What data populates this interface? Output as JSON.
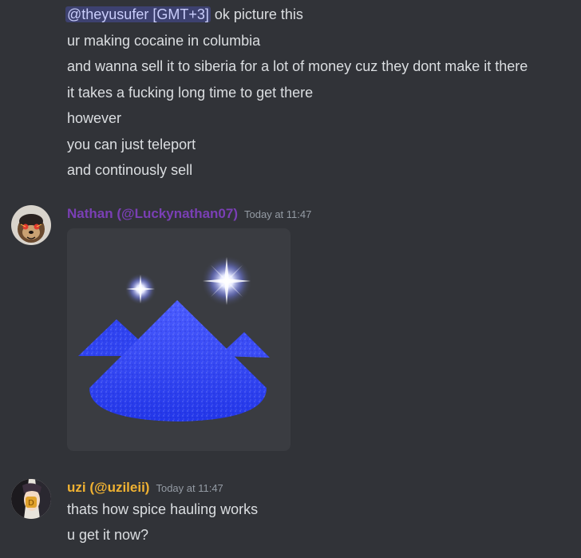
{
  "message1": {
    "mention": "@theyusufer [GMT+3]",
    "first_line_rest": " ok picture this",
    "lines": [
      "ur making cocaine in columbia",
      "and wanna sell it to siberia for a lot of money cuz they dont make it there",
      "it takes a fucking long time to get there",
      "however",
      "you can just teleport",
      "and continously sell"
    ]
  },
  "message2": {
    "username": "Nathan (@Luckynathan07)",
    "username_color": "#7a3fb5",
    "timestamp": "Today at 11:47",
    "avatar": "dog-face-avatar",
    "attachment": "blue-spice-mounds-image"
  },
  "message3": {
    "username": "uzi (@uzileii)",
    "username_color": "#f0b232",
    "timestamp": "Today at 11:47",
    "avatar": "anime-character-avatar",
    "lines": [
      "thats how spice hauling works",
      "u get it now?"
    ]
  },
  "colors": {
    "background": "#313338",
    "text": "#dbdee1",
    "timestamp": "#949ba4",
    "mention_bg": "#3e4278",
    "spice_blue": "#3347ff"
  }
}
